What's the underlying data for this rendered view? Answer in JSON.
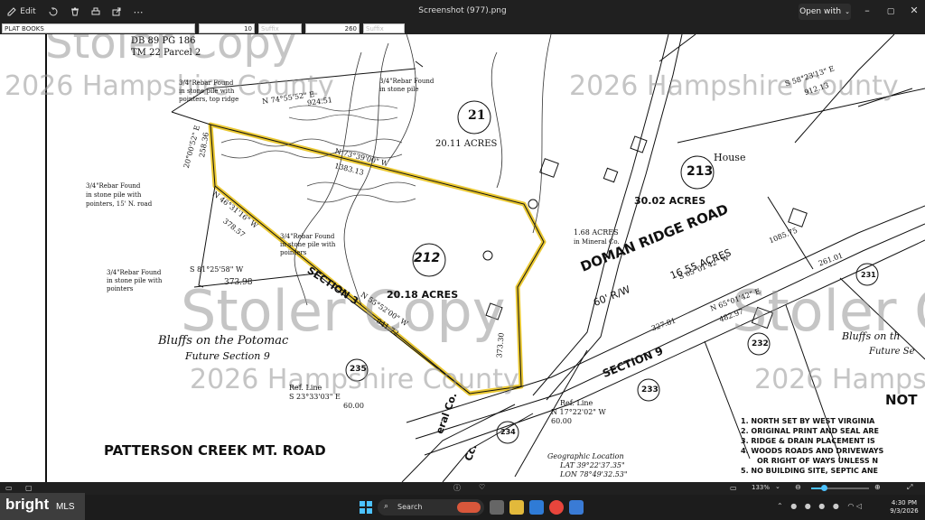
{
  "titlebar": {
    "edit_label": "Edit",
    "title": "Screenshot (977).png",
    "open_with": "Open with",
    "icons": [
      "rotate-icon",
      "delete-icon",
      "print-icon",
      "share-icon",
      "more-icon"
    ]
  },
  "fieldbar": {
    "f1": "PLAT BOOKS",
    "f2": "10",
    "f3": "Suffix",
    "f4": "260",
    "f5": "Suffix"
  },
  "plat": {
    "header1": "DB 89 PG 186",
    "header2": "TM 22 Parcel 2",
    "rebar1_a": "3/4\"Rebar Found",
    "rebar1_b": "in stone pile with",
    "rebar1_c": "pointers, top ridge",
    "rebar2_a": "3/4\"Rebar Found",
    "rebar2_b": "in stone pile",
    "rebar3_a": "3/4\"Rebar Found",
    "rebar3_b": "in stone pile with",
    "rebar3_c": "pointers, 15' N. road",
    "rebar4_a": "3/4\"Rebar Found",
    "rebar4_b": "in stone pile with",
    "rebar4_c": "pointers",
    "rebar5_a": "3/4\"Rebar Found",
    "rebar5_b": "in stone pile with",
    "rebar5_c": "pointers",
    "bearing_top": "N 74°55'52\" E",
    "bearing_top_dist": "924.51",
    "bearing_north": "N 73°39'00\" W",
    "bearing_north_dist": "1383.13",
    "bearing_west1": "20°00'52\" E",
    "bearing_west1_dist": "258.36",
    "bearing_west2": "N 46°31'16\" W",
    "bearing_west2_dist": "378.57",
    "bearing_sw": "S 81°25'58\" W",
    "bearing_sw_dist": "373.98",
    "bearing_south": "N 55°52'00\" W",
    "bearing_south_dist": "941.72",
    "ref_line1": "Ref. Line",
    "ref_line1_b": "S 23°33'03\" E",
    "ref_line1_c": "60.00",
    "ref_line2": "Ref. Line",
    "ref_line2_b": "N 17°22'02\" W",
    "ref_line2_c": "60.00",
    "lot21": "21",
    "lot21_acres": "20.11 ACRES",
    "lot212": "212",
    "lot212_acres": "20.18 ACRES",
    "lot213": "213",
    "lot213_acres": "30.02 ACRES",
    "house": "House",
    "acres_168_a": "1.68 ACRES",
    "acres_168_b": "in Mineral Co.",
    "doman_road": "DOMAN RIDGE ROAD",
    "doman_rw": "60' R/W",
    "doman_acres": "16.55 ACRES",
    "doman_bearing": "S 65°01'42\" W",
    "doman_dist": "1085.75",
    "section3": "SECTION 3",
    "section9": "SECTION 9",
    "bluffs1": "Bluffs on the Potomac",
    "bluffs2": "Future Section 9",
    "bluffs_right": "Bluffs on th",
    "bluffs_right2": "Future Se",
    "lot235": "235",
    "lot233": "233",
    "lot232": "232",
    "lot231": "231",
    "lot234": "234",
    "bearing_e_dist": "373.30",
    "bearing_327": "327.81",
    "bearing_65": "N 65°01'42\" E",
    "bearing_65_dist": "482.97",
    "dist_261": "261.01",
    "patterson": "PATTERSON CREEK MT. ROAD",
    "geo_a": "Geographic Location",
    "geo_b": "LAT 39°22'37.35\"",
    "geo_c": "LON 78°49'32.53\"",
    "mineral_co": "eral Co.",
    "cc": "Cc.",
    "not_header": "NOT",
    "note1": "1.  NORTH SET BY WEST VIRGINIA",
    "note2": "2.  ORIGINAL PRINT AND SEAL ARE",
    "note3": "3.  RIDGE & DRAIN PLACEMENT IS",
    "note4": "4.  WOODS ROADS AND DRIVEWAYS",
    "note4b": "OR RIGHT OF WAYS UNLESS N",
    "note5": "5.  NO BUILDING SITE, SEPTIC ANE",
    "bearing_58": "S 58°23'13\" E",
    "bearing_58_dist": "912.13",
    "wm_top": "2026 Hampshire County",
    "wm_stoler": "Stoler Copy",
    "wm_bottom": "2026 Hampshire County"
  },
  "statusbar": {
    "zoom": "133%"
  },
  "taskbar": {
    "search_placeholder": "Search",
    "time": "4:30 PM",
    "date": "9/3/2026"
  },
  "brand": {
    "name": "bright",
    "suffix": "MLS"
  },
  "colors": {
    "highlight": "#e8c21c",
    "titlebar_bg": "#202020"
  }
}
